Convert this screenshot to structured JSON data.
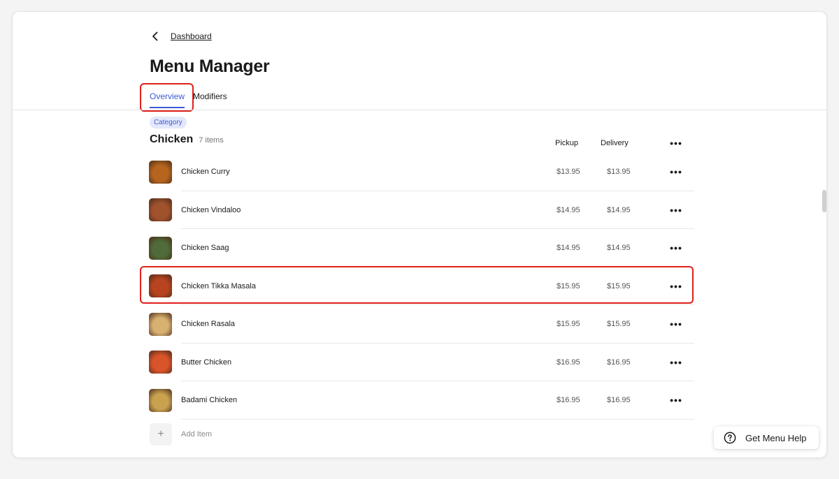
{
  "breadcrumb": {
    "label": "Dashboard"
  },
  "page": {
    "title": "Menu Manager"
  },
  "tabs": [
    {
      "label": "Overview",
      "active": true
    },
    {
      "label": "Modifiers",
      "active": false
    }
  ],
  "category": {
    "badge": "Category",
    "name": "Chicken",
    "count": "7 items",
    "columns": {
      "pickup": "Pickup",
      "delivery": "Delivery"
    }
  },
  "items": [
    {
      "name": "Chicken Curry",
      "pickup": "$13.95",
      "delivery": "$13.95",
      "thumb_color": "#b5651d"
    },
    {
      "name": "Chicken Vindaloo",
      "pickup": "$14.95",
      "delivery": "$14.95",
      "thumb_color": "#a0522d"
    },
    {
      "name": "Chicken Saag",
      "pickup": "$14.95",
      "delivery": "$14.95",
      "thumb_color": "#4f6b3a"
    },
    {
      "name": "Chicken Tikka Masala",
      "pickup": "$15.95",
      "delivery": "$15.95",
      "thumb_color": "#b8441f"
    },
    {
      "name": "Chicken Rasala",
      "pickup": "$15.95",
      "delivery": "$15.95",
      "thumb_color": "#d8b070"
    },
    {
      "name": "Butter Chicken",
      "pickup": "$16.95",
      "delivery": "$16.95",
      "thumb_color": "#d9542a"
    },
    {
      "name": "Badami Chicken",
      "pickup": "$16.95",
      "delivery": "$16.95",
      "thumb_color": "#c9a250"
    }
  ],
  "add_item": {
    "label": "Add Item"
  },
  "help": {
    "label": "Get Menu Help"
  },
  "colors": {
    "accent": "#3b5ad6",
    "highlight": "#e0201a"
  },
  "icons": {
    "back": "chevron-left-icon",
    "more": "more-horizontal-icon",
    "add": "plus-icon",
    "help": "question-circle-icon"
  }
}
